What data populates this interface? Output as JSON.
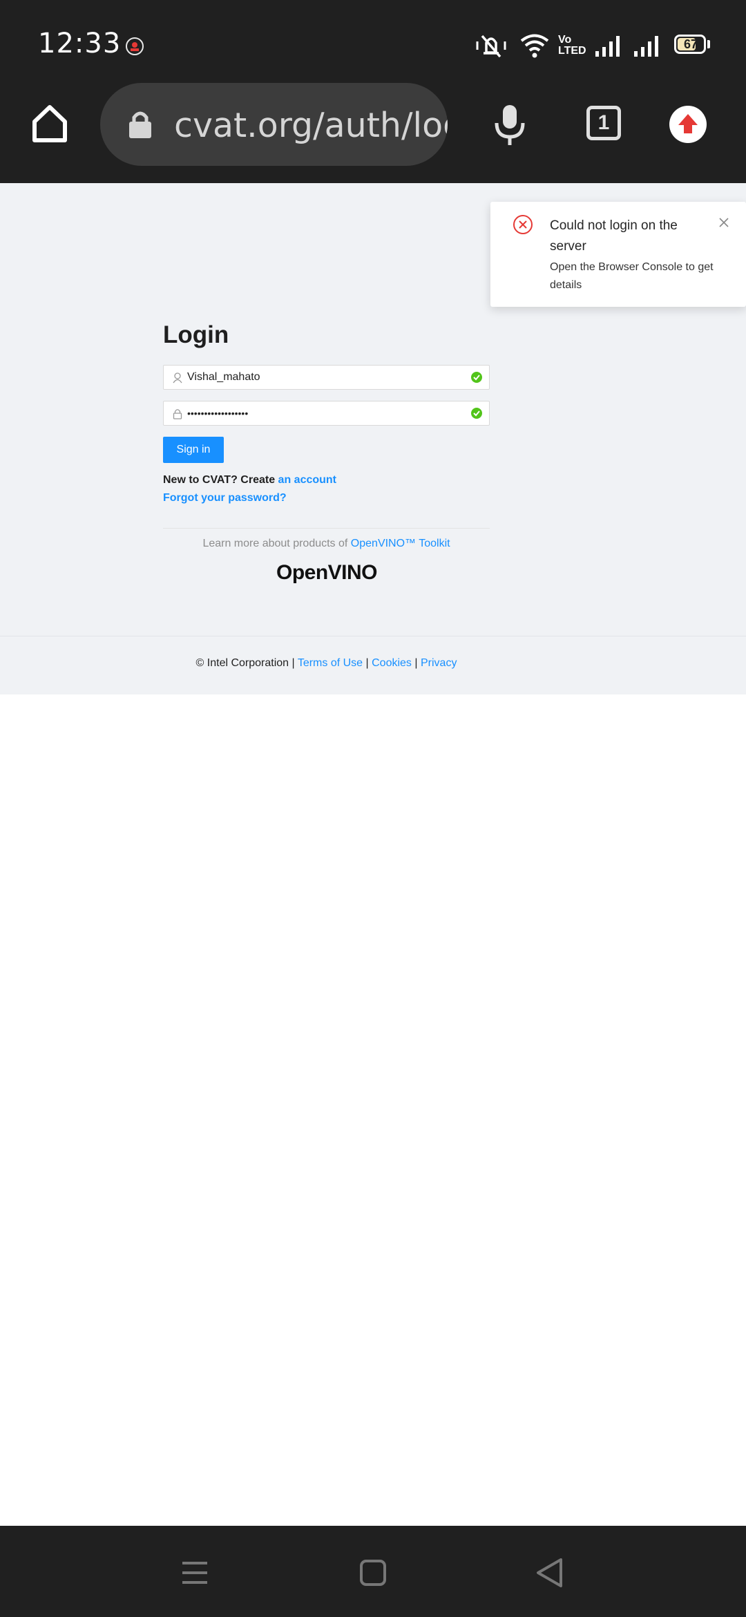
{
  "status_bar": {
    "time": "12:33",
    "volte_label_top": "Vo",
    "volte_label_bottom": "LTED",
    "battery": "67",
    "icons": [
      "record-icon",
      "mute-icon",
      "wifi-icon",
      "volte-icon",
      "signal-icon",
      "signal-icon",
      "battery-icon"
    ]
  },
  "browser": {
    "url": "cvat.org/auth/log",
    "tab_count": "1",
    "icons": [
      "home-icon",
      "lock-icon",
      "mic-icon",
      "tabs-icon",
      "update-icon"
    ]
  },
  "login": {
    "title": "Login",
    "username_value": "Vishal_mahato",
    "password_value": "••••••••••••••••••",
    "signin_label": "Sign in",
    "new_prefix": "New to CVAT? Create ",
    "new_link": "an account",
    "forgot_label": "Forgot your password?",
    "learn_prefix": "Learn more about products of ",
    "learn_link": "OpenVINO™ Toolkit",
    "logo_text": "OpenVINO"
  },
  "footer": {
    "copyright": "© Intel Corporation | ",
    "terms": "Terms of Use",
    "sep1": " | ",
    "cookies": "Cookies",
    "sep2": " | ",
    "privacy": "Privacy"
  },
  "toast": {
    "title": "Could not login on the server",
    "description": "Open the Browser Console to get details"
  },
  "colors": {
    "primary": "#1890ff",
    "success": "#52c41a",
    "error": "#e53935",
    "chrome_dark": "#202020"
  }
}
